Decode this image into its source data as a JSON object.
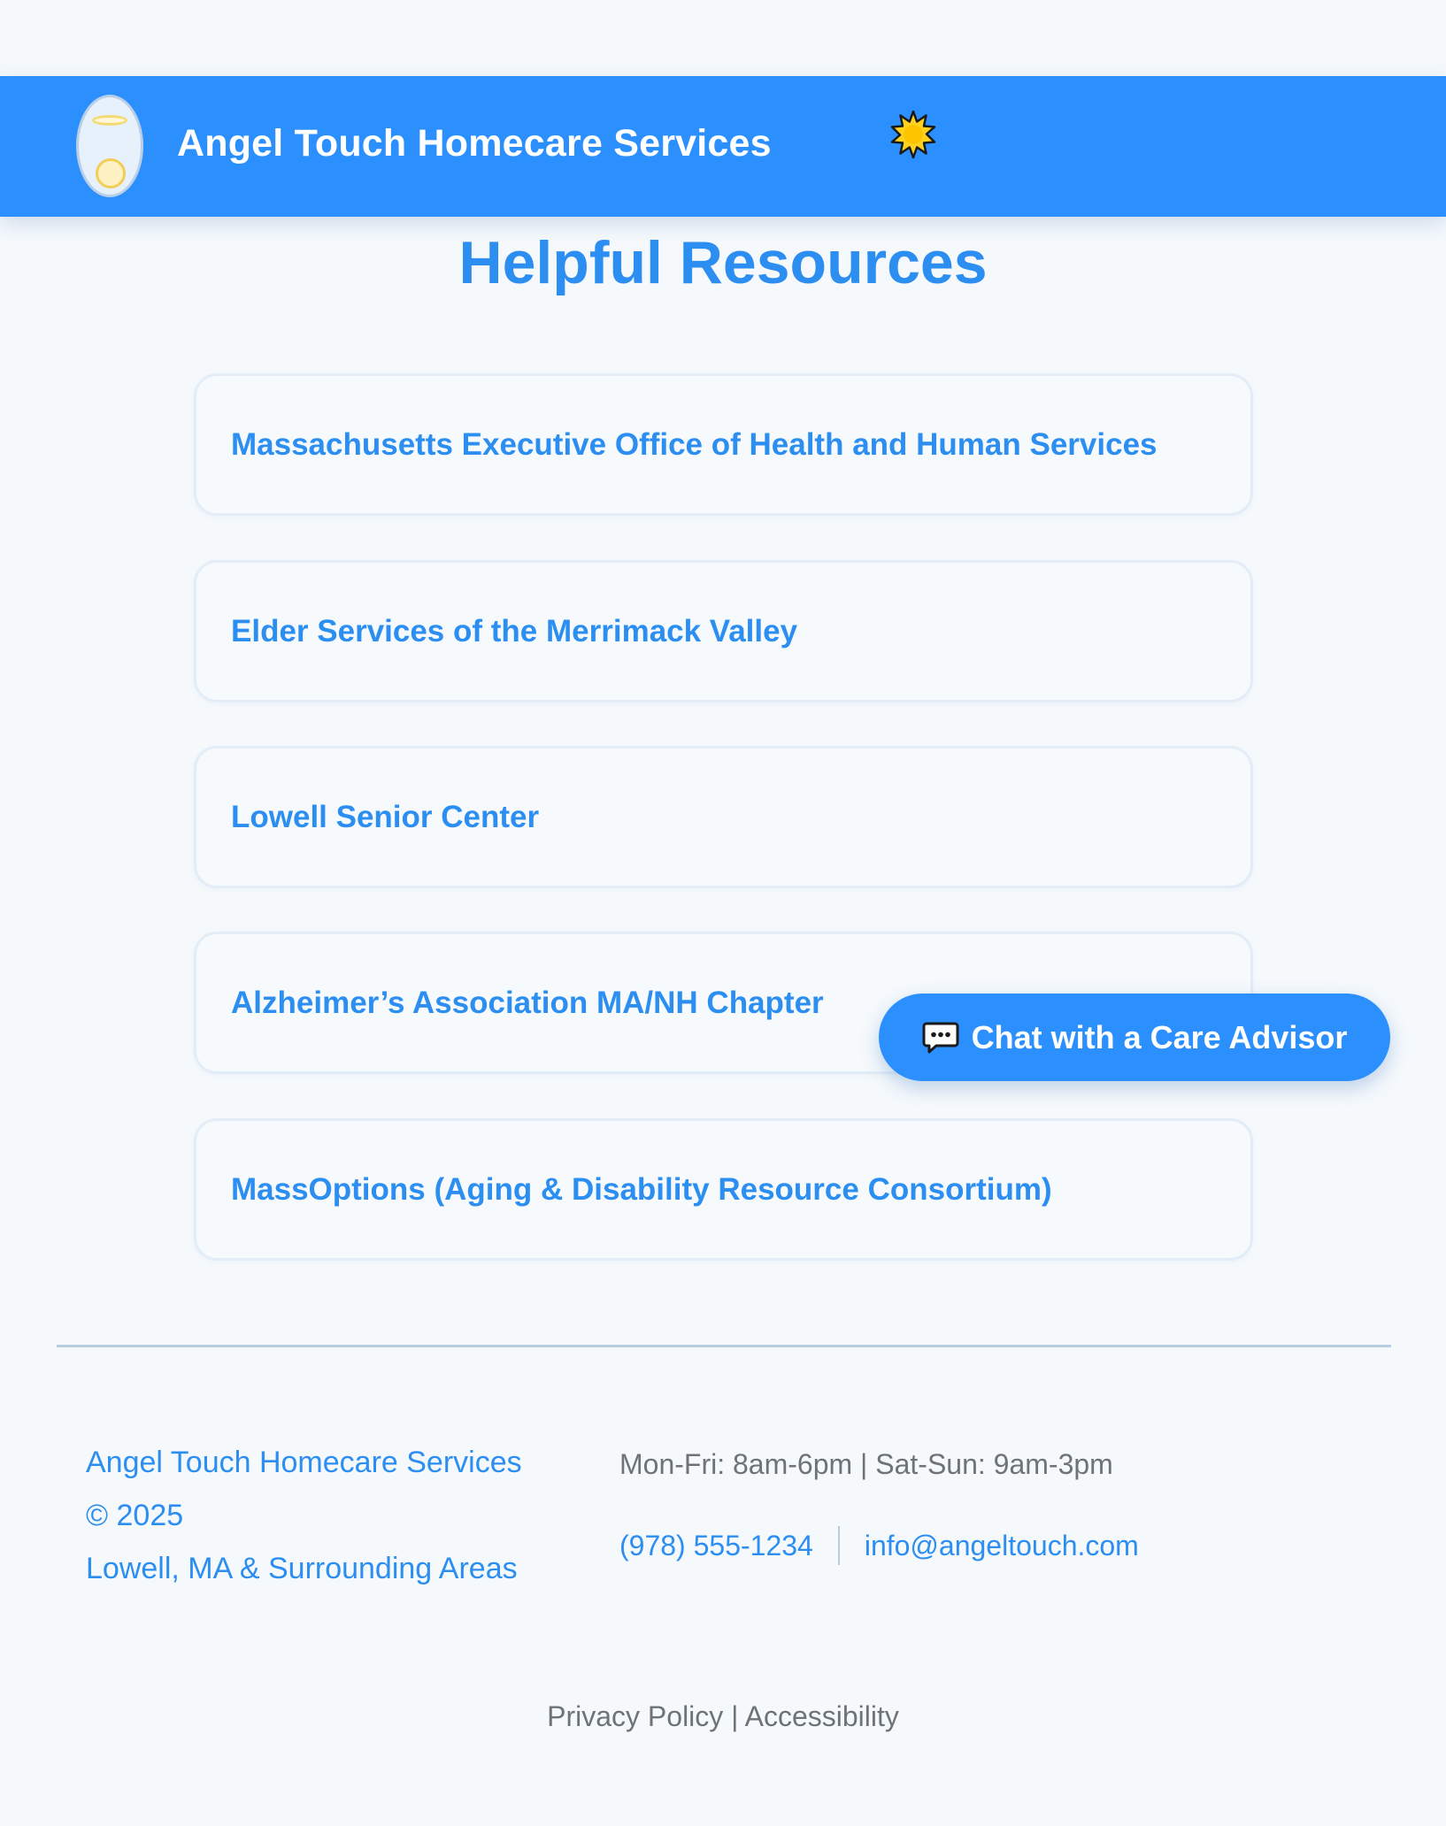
{
  "header": {
    "brand_name": "Angel Touch Homecare Services",
    "logo_icon": "angel-logo-icon",
    "theme_icon": "sun-icon"
  },
  "main": {
    "title": "Helpful Resources",
    "resources": [
      {
        "label": "Massachusetts Executive Office of Health and Human Services"
      },
      {
        "label": "Elder Services of the Merrimack Valley"
      },
      {
        "label": "Lowell Senior Center"
      },
      {
        "label": "Alzheimer’s Association MA/NH Chapter"
      },
      {
        "label": "MassOptions (Aging & Disability Resource Consortium)"
      }
    ]
  },
  "chat": {
    "label": "Chat with a Care Advisor",
    "icon": "speech-bubble-icon"
  },
  "footer": {
    "company": "Angel Touch Homecare Services",
    "copyright": "© 2025",
    "area": "Lowell, MA & Surrounding Areas",
    "hours": "Mon-Fri: 8am-6pm | Sat-Sun: 9am-3pm",
    "phone": "(978) 555-1234",
    "email": "info@angeltouch.com",
    "links": {
      "privacy": "Privacy Policy",
      "separator": "|",
      "accessibility": "Accessibility"
    }
  },
  "colors": {
    "primary": "#2b90fe",
    "link": "#2b8ef0",
    "background": "#f5f9fc",
    "muted_text": "#6e7378"
  }
}
